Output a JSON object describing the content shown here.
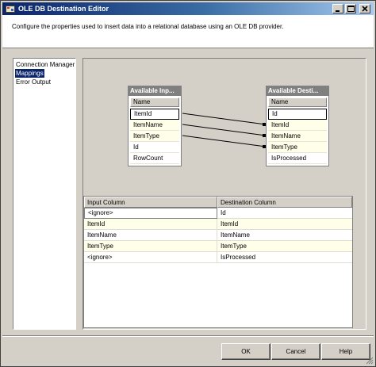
{
  "window": {
    "title": "OLE DB Destination Editor",
    "description": "Configure the properties used to insert data into a relational database using an OLE DB provider."
  },
  "nav": {
    "items": [
      {
        "label": "Connection Manager"
      },
      {
        "label": "Mappings",
        "selected": true
      },
      {
        "label": "Error Output"
      }
    ]
  },
  "diagram": {
    "input_box": {
      "title": "Available Inp...",
      "column_header": "Name",
      "rows": [
        "ItemId",
        "ItemName",
        "ItemType",
        "Id",
        "RowCount"
      ]
    },
    "dest_box": {
      "title": "Available Desti...",
      "column_header": "Name",
      "rows": [
        "Id",
        "ItemId",
        "ItemName",
        "ItemType",
        "IsProcessed"
      ]
    }
  },
  "grid": {
    "headers": {
      "input": "Input Column",
      "dest": "Destination Column"
    },
    "rows": [
      {
        "input": "<ignore>",
        "dest": "Id"
      },
      {
        "input": "ItemId",
        "dest": "ItemId"
      },
      {
        "input": "ItemName",
        "dest": "ItemName"
      },
      {
        "input": "ItemType",
        "dest": "ItemType"
      },
      {
        "input": "<ignore>",
        "dest": "IsProcessed"
      }
    ]
  },
  "buttons": {
    "ok": "OK",
    "cancel": "Cancel",
    "help": "Help"
  },
  "colors": {
    "titlebar_start": "#0a246a",
    "titlebar_end": "#a6caf0",
    "selection": "#0a246a",
    "mapped_row": "#fffee8",
    "dialog_face": "#d4d0c8"
  }
}
